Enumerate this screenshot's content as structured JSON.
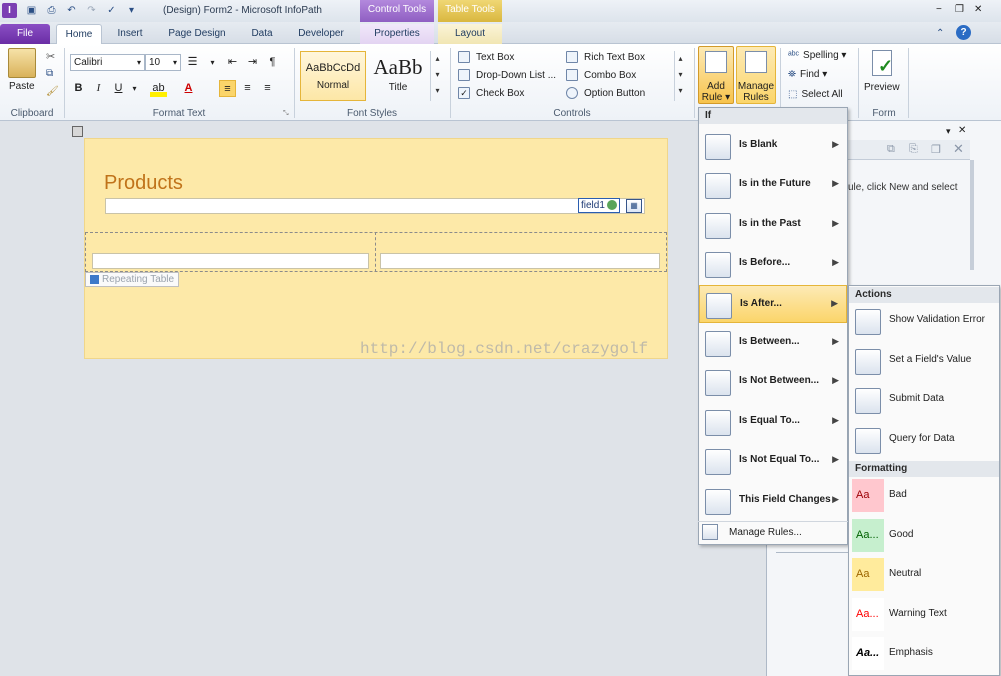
{
  "window": {
    "title": "(Design) Form2 - Microsoft InfoPath",
    "controls": {
      "minimize": "−",
      "restore": "❐",
      "close": "✕"
    }
  },
  "context_groups": {
    "control_tools": "Control Tools",
    "table_tools": "Table Tools"
  },
  "tabs": [
    "File",
    "Home",
    "Insert",
    "Page Design",
    "Data",
    "Developer",
    "Properties",
    "Layout"
  ],
  "ribbon": {
    "clipboard": {
      "paste": "Paste",
      "label": "Clipboard"
    },
    "format_text": {
      "font": "Calibri",
      "size": "10",
      "bold": "B",
      "italic": "I",
      "underline": "U",
      "font_color": "A",
      "label": "Format Text"
    },
    "font_styles": {
      "normal_preview": "AaBbCcDd",
      "normal": "Normal",
      "title_preview": "AaBb",
      "title": "Title",
      "label": "Font Styles"
    },
    "controls": {
      "items": [
        "Text Box",
        "Rich Text Box",
        "Drop-Down List ...",
        "Combo Box",
        "Check Box",
        "Option Button"
      ],
      "label": "Controls"
    },
    "rules": {
      "add_rule": "Add\nRule",
      "add_rule_1": "Add",
      "add_rule_2": "Rule",
      "manage_1": "Manage",
      "manage_2": "Rules"
    },
    "editing": {
      "spelling": "Spelling",
      "find": "Find",
      "select_all": "Select All"
    },
    "form": {
      "preview": "Preview",
      "label": "Form"
    }
  },
  "form": {
    "title": "Products",
    "field_tag": "field1",
    "repeating_table_label": "Repeating Table",
    "watermark": "http://blog.csdn.net/crazygolf"
  },
  "task_pane": {
    "hint": "ule, click New and select"
  },
  "if_menu": {
    "header": "If",
    "items": [
      "Is Blank",
      "Is in the Future",
      "Is in the Past",
      "Is Before...",
      "Is After...",
      "Is Between...",
      "Is Not Between...",
      "Is Equal To...",
      "Is Not Equal To...",
      "This Field Changes"
    ],
    "highlighted_index": 4,
    "manage": "Manage Rules..."
  },
  "actions_menu": {
    "actions_header": "Actions",
    "actions": [
      "Show Validation Error",
      "Set a Field's Value",
      "Submit Data",
      "Query for Data"
    ],
    "formatting_header": "Formatting",
    "formatting": [
      {
        "sample": "Aa",
        "label": "Bad",
        "bg": "#ffc7ce",
        "fg": "#9c0006"
      },
      {
        "sample": "Aa...",
        "label": "Good",
        "bg": "#c6efce",
        "fg": "#006100"
      },
      {
        "sample": "Aa",
        "label": "Neutral",
        "bg": "#ffeb9c",
        "fg": "#9c6500"
      },
      {
        "sample": "Aa...",
        "label": "Warning Text",
        "bg": "#ffffff",
        "fg": "#ff0000"
      },
      {
        "sample": "Aa...",
        "label": "Emphasis",
        "bg": "#ffffff",
        "fg": "#000000"
      }
    ]
  },
  "colors": {
    "accent": "#2b579a",
    "context_purple": "#9a6cc6",
    "context_yellow": "#e2c455",
    "highlight": "#fbd56a"
  }
}
